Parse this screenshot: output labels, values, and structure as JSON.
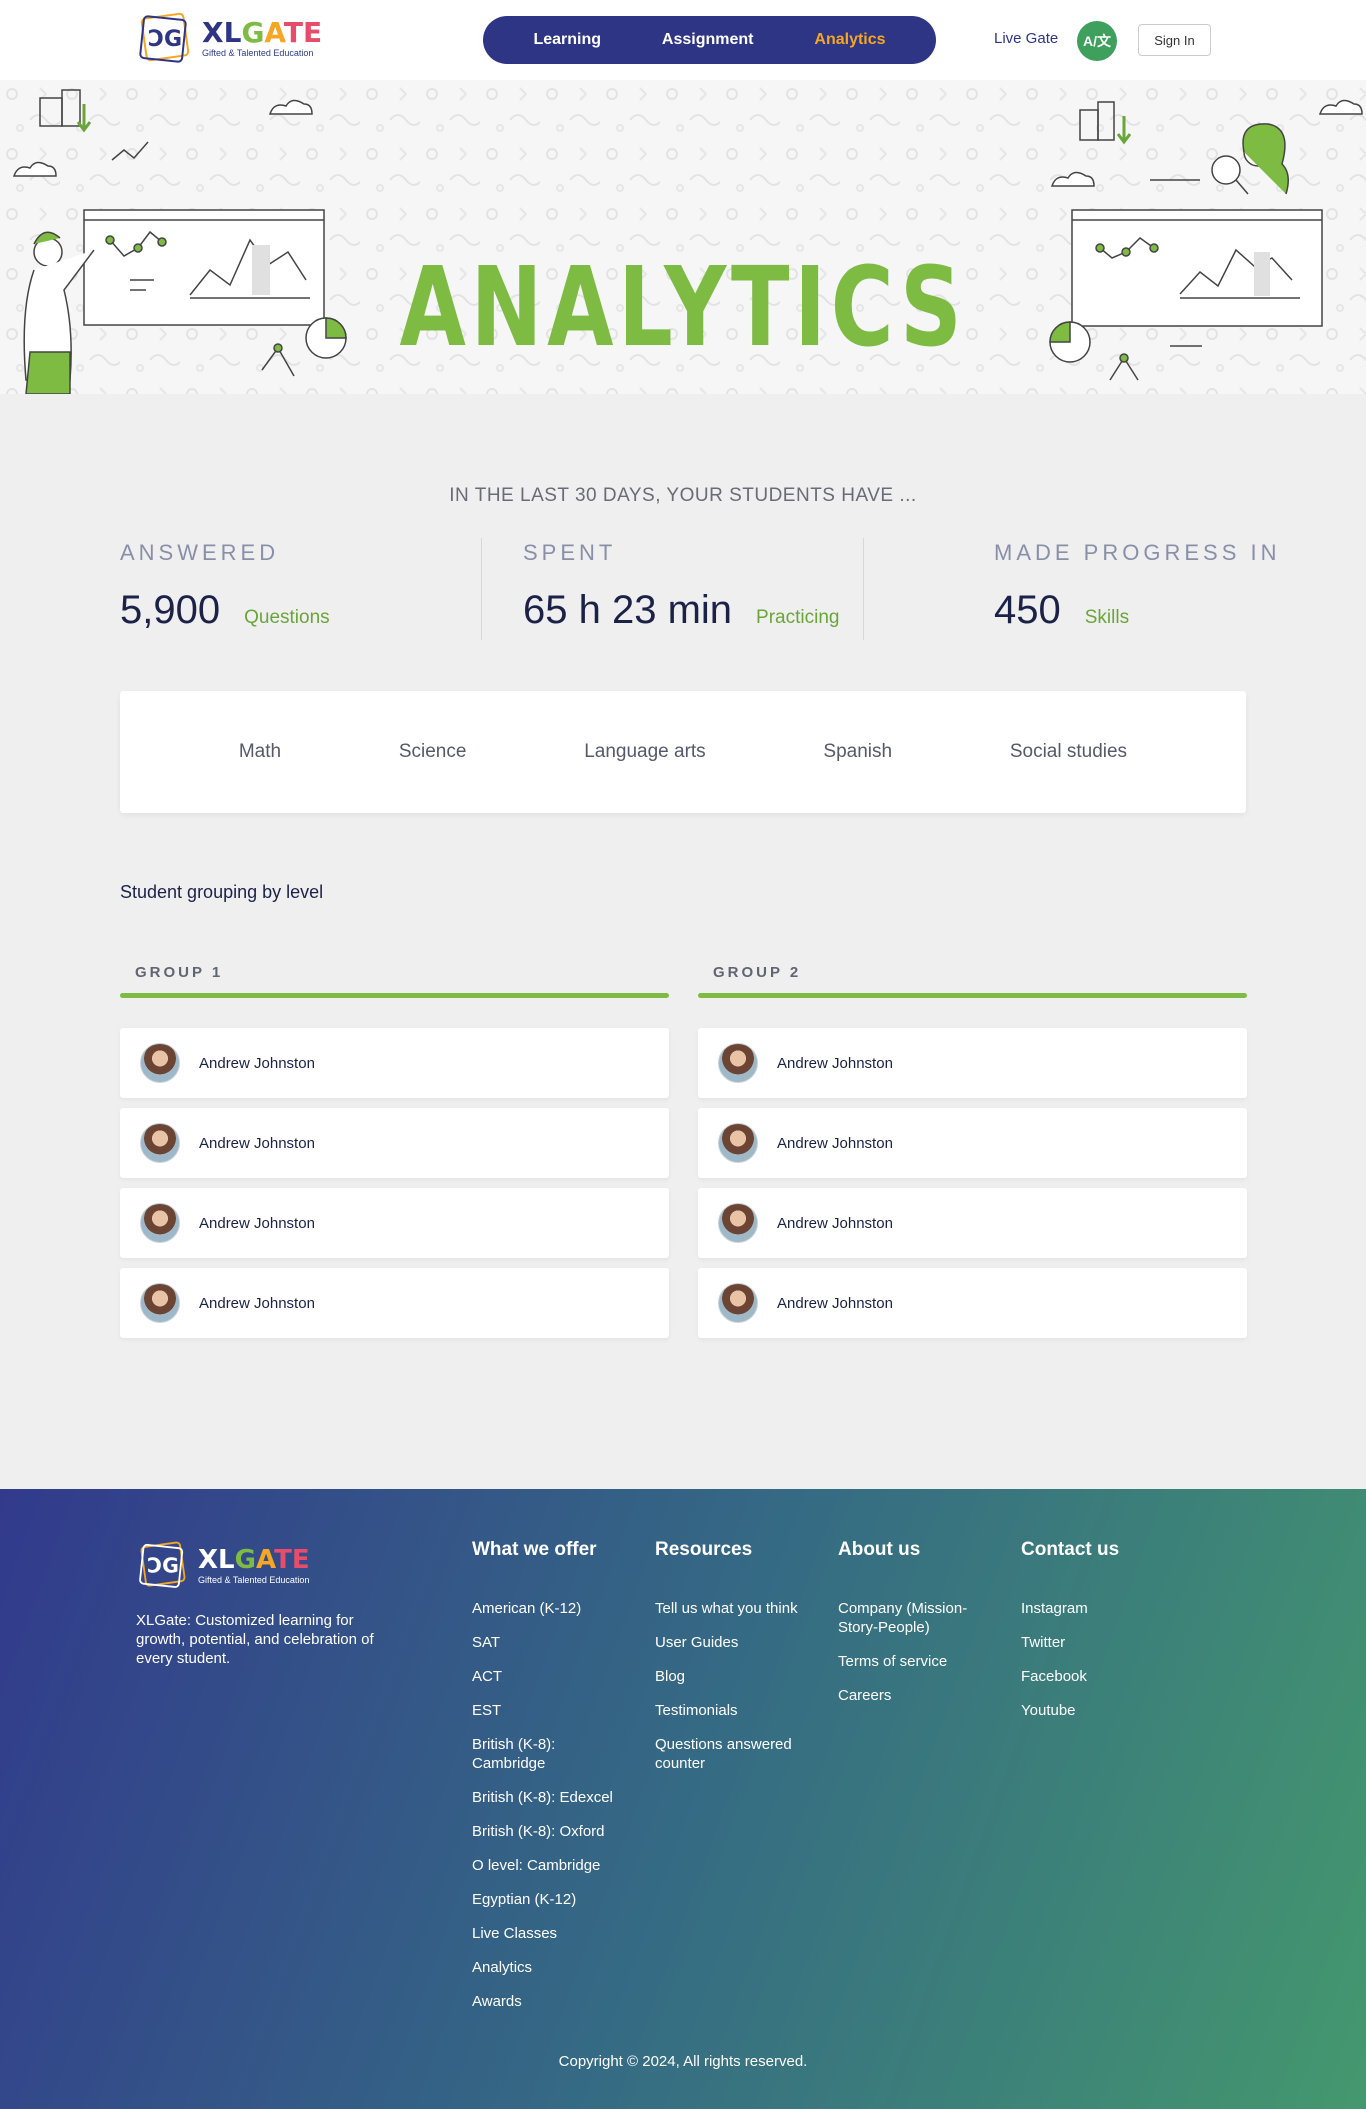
{
  "brand": {
    "name": "XLGATE",
    "tagline": "Gifted & Talented Education",
    "colors": {
      "navy": "#2e3585",
      "green": "#7dbb42",
      "orange": "#f5a623"
    }
  },
  "nav": {
    "items": [
      "Learning",
      "Assignment",
      "Analytics"
    ],
    "active": "Analytics",
    "live_gate": "Live Gate",
    "lang": "A/文",
    "sign_in": "Sign In"
  },
  "hero": {
    "title": "ANALYTICS"
  },
  "stats": {
    "intro": "IN THE LAST 30 DAYS, YOUR STUDENTS HAVE ...",
    "items": [
      {
        "label": "ANSWERED",
        "value": "5,900",
        "unit": "Questions"
      },
      {
        "label": "SPENT",
        "value": "65 h 23 min",
        "unit": "Practicing"
      },
      {
        "label": "MADE PROGRESS IN",
        "value": "450",
        "unit": "Skills"
      }
    ]
  },
  "subjects": [
    "Math",
    "Science",
    "Language arts",
    "Spanish",
    "Social studies"
  ],
  "grouping": {
    "title": "Student grouping by level",
    "groups": [
      {
        "title": "GROUP 1",
        "students": [
          "Andrew Johnston",
          "Andrew Johnston",
          "Andrew Johnston",
          "Andrew Johnston"
        ]
      },
      {
        "title": "GROUP 2",
        "students": [
          "Andrew Johnston",
          "Andrew Johnston",
          "Andrew Johnston",
          "Andrew Johnston"
        ]
      }
    ]
  },
  "footer": {
    "description": "XLGate: Customized learning for growth, potential, and celebration of every student.",
    "columns": [
      {
        "title": "What we offer",
        "links": [
          "American (K-12)",
          "SAT",
          "ACT",
          "EST",
          "British (K-8): Cambridge",
          "British (K-8): Edexcel",
          "British (K-8): Oxford",
          "O level: Cambridge",
          "Egyptian (K-12)",
          "Live Classes",
          "Analytics",
          "Awards"
        ]
      },
      {
        "title": "Resources",
        "links": [
          "Tell us what you think",
          "User Guides",
          "Blog",
          "Testimonials",
          "Questions answered counter"
        ]
      },
      {
        "title": "About us",
        "links": [
          "Company (Mission-Story-People)",
          "Terms of service",
          "Careers"
        ]
      },
      {
        "title": "Contact us",
        "links": [
          "Instagram",
          "Twitter",
          "Facebook",
          "Youtube"
        ]
      }
    ],
    "copyright": "Copyright © 2024, All rights reserved."
  }
}
